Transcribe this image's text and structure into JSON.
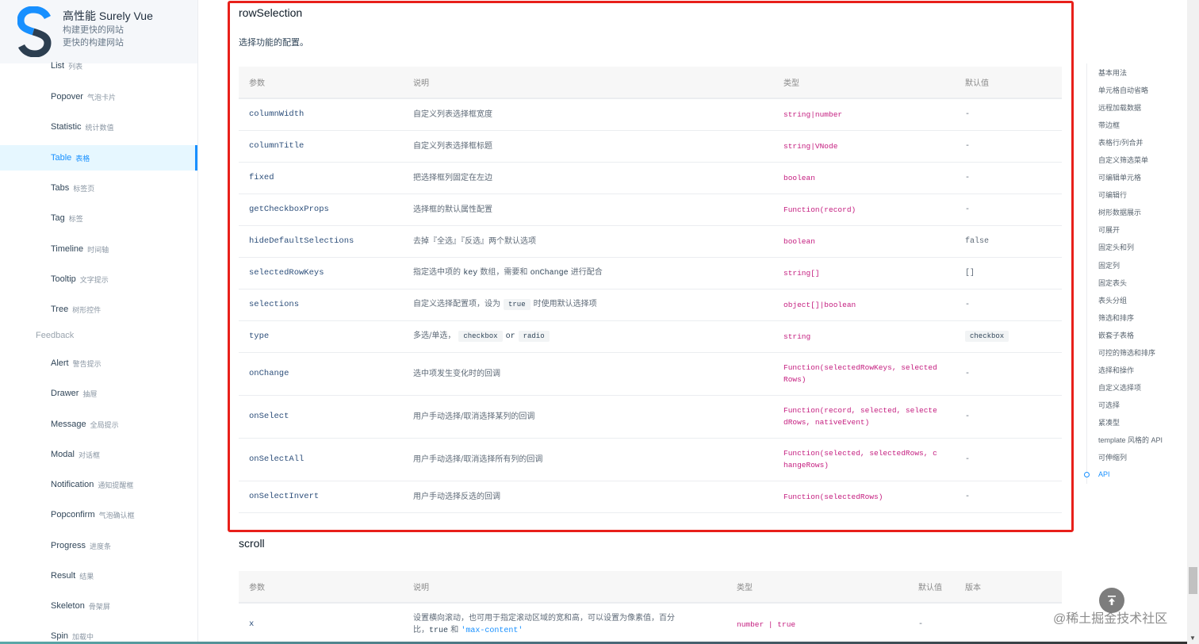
{
  "brand": {
    "title": "高性能 Surely Vue",
    "subtitle_1": "构建更快的网站",
    "subtitle_2": "更快的构建网站",
    "logo_colors": {
      "primary": "#1890ff",
      "secondary": "#2c3e50"
    }
  },
  "sidebar": {
    "items": [
      {
        "en": "List",
        "cn": "列表"
      },
      {
        "en": "Popover",
        "cn": "气泡卡片"
      },
      {
        "en": "Statistic",
        "cn": "统计数值"
      },
      {
        "en": "Table",
        "cn": "表格",
        "active": true
      },
      {
        "en": "Tabs",
        "cn": "标签页"
      },
      {
        "en": "Tag",
        "cn": "标签"
      },
      {
        "en": "Timeline",
        "cn": "时间轴"
      },
      {
        "en": "Tooltip",
        "cn": "文字提示"
      },
      {
        "en": "Tree",
        "cn": "树形控件"
      }
    ],
    "group_feedback": "Feedback",
    "feedback_items": [
      {
        "en": "Alert",
        "cn": "警告提示"
      },
      {
        "en": "Drawer",
        "cn": "抽屉"
      },
      {
        "en": "Message",
        "cn": "全局提示"
      },
      {
        "en": "Modal",
        "cn": "对话框"
      },
      {
        "en": "Notification",
        "cn": "通知提醒框"
      },
      {
        "en": "Popconfirm",
        "cn": "气泡确认框"
      },
      {
        "en": "Progress",
        "cn": "进度条"
      },
      {
        "en": "Result",
        "cn": "结果"
      },
      {
        "en": "Skeleton",
        "cn": "骨架屏"
      },
      {
        "en": "Spin",
        "cn": "加载中"
      }
    ]
  },
  "row_selection": {
    "title": "rowSelection",
    "description": "选择功能的配置。",
    "headers": [
      "参数",
      "说明",
      "类型",
      "默认值"
    ],
    "rows": [
      {
        "name": "columnWidth",
        "desc": "自定义列表选择框宽度",
        "type": "string|number",
        "default": "-"
      },
      {
        "name": "columnTitle",
        "desc": "自定义列表选择框标题",
        "type": "string|VNode",
        "default": "-"
      },
      {
        "name": "fixed",
        "desc": "把选择框列固定在左边",
        "type": "boolean",
        "default": "-"
      },
      {
        "name": "getCheckboxProps",
        "desc": "选择框的默认属性配置",
        "type": "Function(record)",
        "default": "-"
      },
      {
        "name": "hideDefaultSelections",
        "desc": "去掉『全选』『反选』两个默认选项",
        "type": "boolean",
        "default": "false"
      },
      {
        "name": "selectedRowKeys",
        "desc_parts": [
          "指定选中项的 ",
          "key",
          " 数组，需要和 ",
          "onChange",
          " 进行配合"
        ],
        "type": "string[]",
        "default": "[]"
      },
      {
        "name": "selections",
        "desc_parts": [
          "自定义选择配置项，设为",
          "true",
          "时使用默认选择项"
        ],
        "type": "object[]|boolean",
        "default": "-"
      },
      {
        "name": "type",
        "desc_parts": [
          "多选/单选，",
          "checkbox",
          "or",
          "radio"
        ],
        "type": "string",
        "default": "checkbox",
        "default_is_code": true
      },
      {
        "name": "onChange",
        "desc": "选中项发生变化时的回调",
        "type": "Function(selectedRowKeys, selectedRows)",
        "default": "-"
      },
      {
        "name": "onSelect",
        "desc": "用户手动选择/取消选择某列的回调",
        "type": "Function(record, selected, selectedRows, nativeEvent)",
        "default": "-"
      },
      {
        "name": "onSelectAll",
        "desc": "用户手动选择/取消选择所有列的回调",
        "type": "Function(selected, selectedRows, changeRows)",
        "default": "-"
      },
      {
        "name": "onSelectInvert",
        "desc": "用户手动选择反选的回调",
        "type": "Function(selectedRows)",
        "default": "-"
      }
    ]
  },
  "scroll": {
    "title": "scroll",
    "headers": [
      "参数",
      "说明",
      "类型",
      "默认值",
      "版本"
    ],
    "rows": [
      {
        "name": "x",
        "desc_line1": "设置横向滚动，也可用于指定滚动区域的宽和高，可以设置为像素值，百分",
        "desc_line2_parts": [
          "比，",
          "true",
          " 和 ",
          "'max-content'"
        ],
        "type": "number | true",
        "default": "-",
        "version": ""
      }
    ]
  },
  "toc": {
    "items": [
      "基本用法",
      "单元格自动省略",
      "远程加载数据",
      "带边框",
      "表格行/列合并",
      "自定义筛选菜单",
      "可编辑单元格",
      "可编辑行",
      "树形数据展示",
      "可展开",
      "固定头和列",
      "固定列",
      "固定表头",
      "表头分组",
      "筛选和排序",
      "嵌套子表格",
      "可控的筛选和排序",
      "选择和操作",
      "自定义选择项",
      "可选择",
      "紧凑型",
      "template 风格的 API",
      "可伸缩列",
      "API"
    ],
    "active_index": 23
  },
  "back_top_icon": "arrow-up-to-line-icon",
  "watermark": "@稀土掘金技术社区",
  "colors": {
    "accent": "#1890ff",
    "type_text": "#c41d7f",
    "highlight_border": "#e8201a"
  }
}
